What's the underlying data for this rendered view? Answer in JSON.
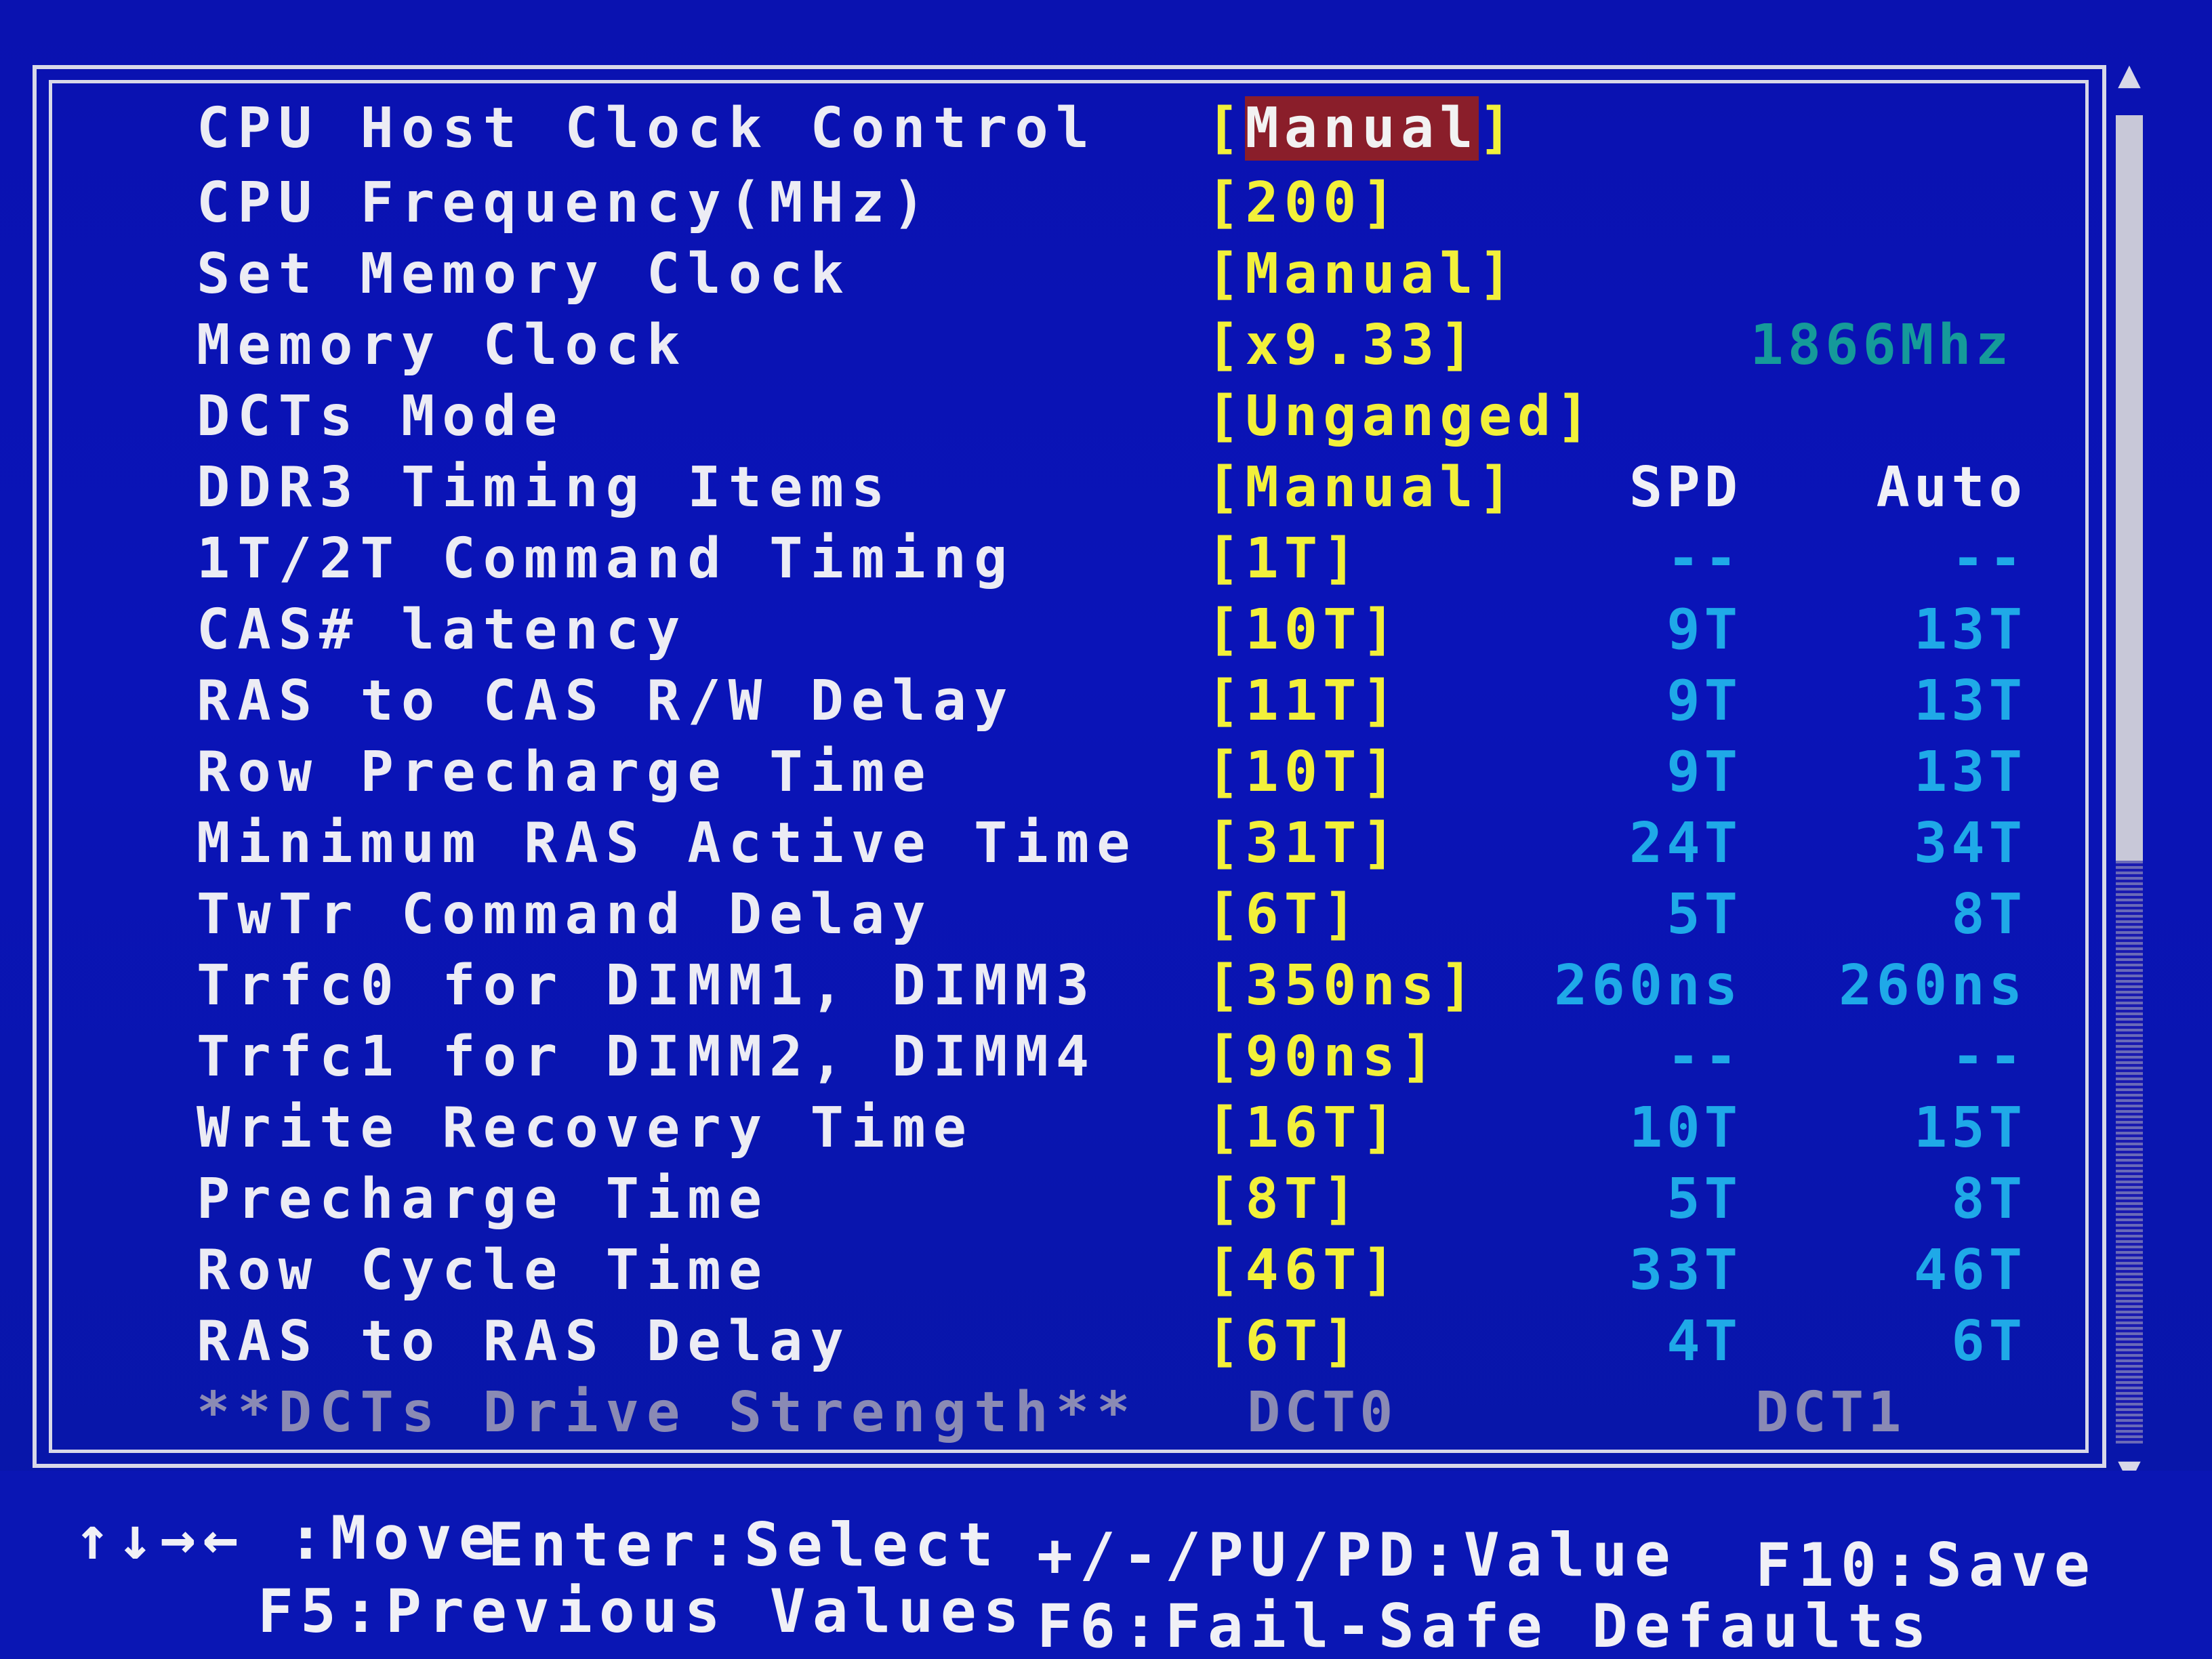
{
  "header": {
    "spd": "SPD",
    "auto": "Auto"
  },
  "settings": [
    {
      "label": "CPU Host Clock Control",
      "value": "[Manual]",
      "selected": true
    },
    {
      "label": "CPU Frequency(MHz)",
      "value": "[200]"
    },
    {
      "label": "Set Memory Clock",
      "value": "[Manual]"
    },
    {
      "label": "Memory Clock",
      "value": "[x9.33]",
      "info": "1866Mhz"
    },
    {
      "label": "DCTs Mode",
      "value": "[Unganged]"
    },
    {
      "label": "DDR3 Timing Items",
      "value": "[Manual]"
    },
    {
      "label": "1T/2T Command Timing",
      "value": "[1T]",
      "spd": "--",
      "auto": "--"
    },
    {
      "label": "CAS# latency",
      "value": "[10T]",
      "spd": "9T",
      "auto": "13T"
    },
    {
      "label": "RAS to CAS R/W Delay",
      "value": "[11T]",
      "spd": "9T",
      "auto": "13T"
    },
    {
      "label": "Row Precharge Time",
      "value": "[10T]",
      "spd": "9T",
      "auto": "13T"
    },
    {
      "label": "Minimum RAS Active Time",
      "value": "[31T]",
      "spd": "24T",
      "auto": "34T"
    },
    {
      "label": "TwTr Command Delay",
      "value": "[6T]",
      "spd": "5T",
      "auto": "8T"
    },
    {
      "label": "Trfc0 for DIMM1, DIMM3",
      "value": "[350ns]",
      "spd": "260ns",
      "auto": "260ns"
    },
    {
      "label": "Trfc1 for DIMM2, DIMM4",
      "value": "[90ns]",
      "spd": "--",
      "auto": "--"
    },
    {
      "label": "Write Recovery Time",
      "value": "[16T]",
      "spd": "10T",
      "auto": "15T"
    },
    {
      "label": "Precharge Time",
      "value": "[8T]",
      "spd": "5T",
      "auto": "8T"
    },
    {
      "label": "Row Cycle Time",
      "value": "[46T]",
      "spd": "33T",
      "auto": "46T"
    },
    {
      "label": "RAS to RAS Delay",
      "value": "[6T]",
      "spd": "4T",
      "auto": "6T"
    }
  ],
  "section": {
    "label": "**DCTs Drive Strength**",
    "dct0": "DCT0",
    "dct1": "DCT1"
  },
  "footer": {
    "move": "↑↓→← :Move",
    "select": "Enter:Select",
    "value": "+/-/PU/PD:Value",
    "save": "F10:Save",
    "previous": "F5:Previous Values",
    "failsafe": "F6:Fail-Safe Defaults"
  },
  "colors": {
    "background": "#0a14b8",
    "value": "#f2f03a",
    "highlight": "#8a1e2a",
    "spd": "#1fa9e8",
    "label": "#ececf4"
  }
}
